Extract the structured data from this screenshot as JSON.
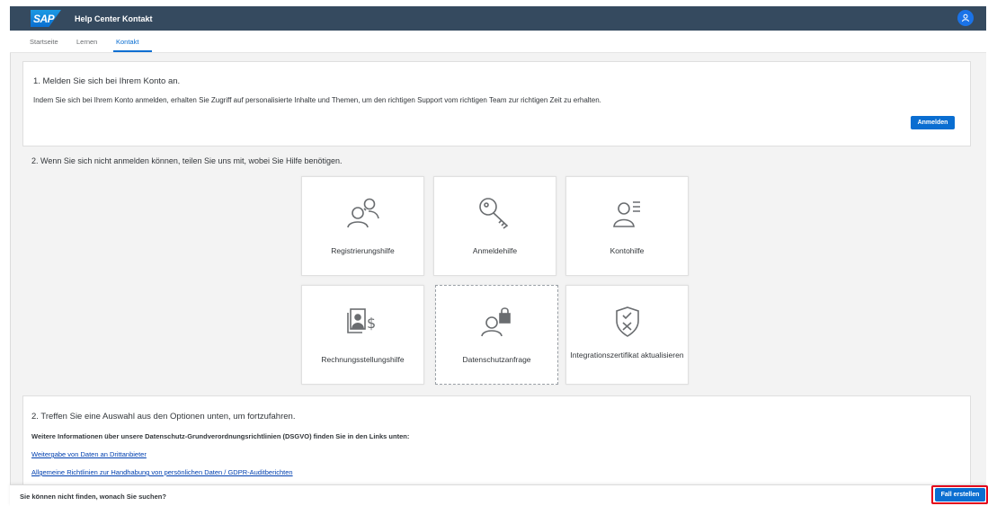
{
  "shell": {
    "logo_text": "SAP",
    "title": "Help Center Kontakt"
  },
  "tabs": [
    {
      "label": "Startseite"
    },
    {
      "label": "Lernen"
    },
    {
      "label": "Kontakt"
    }
  ],
  "login_card": {
    "heading": "1. Melden Sie sich bei Ihrem Konto an.",
    "text": "Indem Sie sich bei Ihrem Konto anmelden, erhalten Sie Zugriff auf personalisierte Inhalte und Themen, um den richtigen Support vom richtigen Team zur richtigen Zeit zu erhalten.",
    "button": "Anmelden"
  },
  "help_section": {
    "heading": "2. Wenn Sie sich nicht anmelden können, teilen Sie uns mit, wobei Sie Hilfe benötigen.",
    "tiles": [
      {
        "label": "Registrierungshilfe",
        "icon": "users-icon"
      },
      {
        "label": "Anmeldehilfe",
        "icon": "key-icon"
      },
      {
        "label": "Kontohilfe",
        "icon": "user-list-icon"
      },
      {
        "label": "Rechnungsstellungshilfe",
        "icon": "billing-icon"
      },
      {
        "label": "Datenschutzanfrage",
        "icon": "user-lock-icon"
      },
      {
        "label": "Integrationszertifikat aktualisieren",
        "icon": "shield-check-icon"
      }
    ]
  },
  "options_card": {
    "heading": "2. Treffen Sie eine Auswahl aus den Optionen unten, um fortzufahren.",
    "bold_text": "Weitere Informationen über unsere Datenschutz-Grundverordnungsrichtlinien (DSGVO) finden Sie in den Links unten:",
    "links": [
      "Weitergabe von Daten an Drittanbieter",
      "Allgemeine Richtlinien zur Handhabung von persönlichen Daten / GDPR-Auditberichten"
    ]
  },
  "footer": {
    "text": "Sie können nicht finden, wonach Sie suchen?",
    "button": "Fall erstellen"
  },
  "colors": {
    "shell": "#354a5f",
    "accent": "#0a6ed1",
    "highlight": "#e3001b"
  }
}
